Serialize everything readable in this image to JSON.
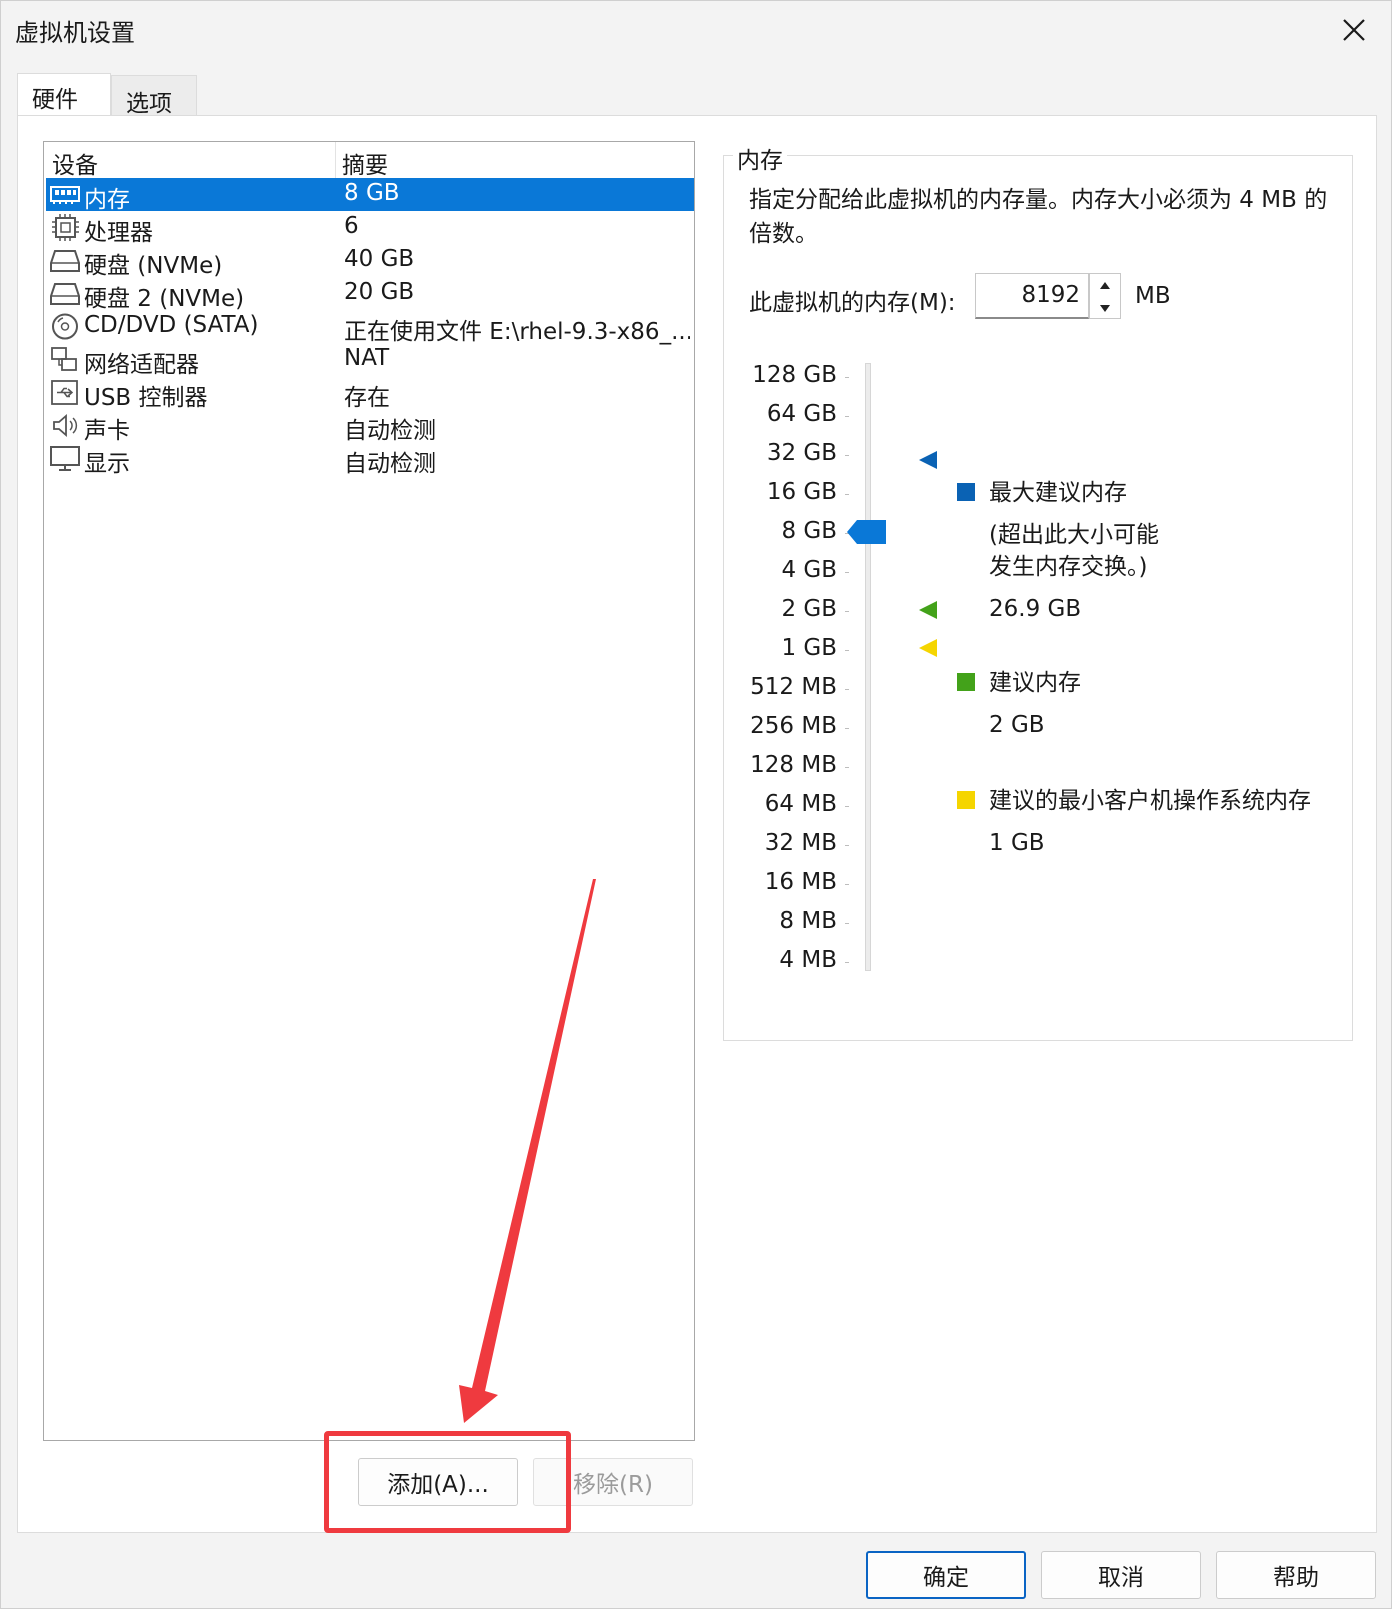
{
  "window": {
    "title": "虚拟机设置"
  },
  "tabs": [
    {
      "label": "硬件"
    },
    {
      "label": "选项"
    }
  ],
  "device_list": {
    "header_device": "设备",
    "header_summary": "摘要",
    "rows": [
      {
        "name": "内存",
        "summary": "8 GB",
        "icon": "memory-icon"
      },
      {
        "name": "处理器",
        "summary": "6",
        "icon": "cpu-icon"
      },
      {
        "name": "硬盘 (NVMe)",
        "summary": "40 GB",
        "icon": "harddisk-icon"
      },
      {
        "name": "硬盘 2 (NVMe)",
        "summary": "20 GB",
        "icon": "harddisk-icon"
      },
      {
        "name": "CD/DVD (SATA)",
        "summary": "正在使用文件 E:\\rhel-9.3-x86_...",
        "icon": "cd-icon"
      },
      {
        "name": "网络适配器",
        "summary": "NAT",
        "icon": "network-icon"
      },
      {
        "name": "USB 控制器",
        "summary": "存在",
        "icon": "usb-icon"
      },
      {
        "name": "声卡",
        "summary": "自动检测",
        "icon": "sound-icon"
      },
      {
        "name": "显示",
        "summary": "自动检测",
        "icon": "display-icon"
      }
    ]
  },
  "list_buttons": {
    "add": "添加(A)...",
    "remove": "移除(R)"
  },
  "memory": {
    "group_title": "内存",
    "description": "指定分配给此虚拟机的内存量。内存大小必须为 4 MB 的倍数。",
    "field_label": "此虚拟机的内存(M):",
    "value": "8192",
    "unit": "MB",
    "scale": [
      "128 GB",
      "64 GB",
      "32 GB",
      "16 GB",
      "8 GB",
      "4 GB",
      "2 GB",
      "1 GB",
      "512 MB",
      "256 MB",
      "128 MB",
      "64 MB",
      "32 MB",
      "16 MB",
      "8 MB",
      "4 MB"
    ],
    "legend": {
      "max_title": "最大建议内存",
      "max_note_1": "(超出此大小可能",
      "max_note_2": "发生内存交换。)",
      "max_value": "26.9 GB",
      "rec_title": "建议内存",
      "rec_value": "2 GB",
      "min_title": "建议的最小客户机操作系统内存",
      "min_value": "1 GB"
    },
    "colors": {
      "max": "#0a62b4",
      "rec": "#43a21a",
      "min": "#f5d500",
      "slider": "#0a78d7"
    }
  },
  "dialog_buttons": {
    "ok": "确定",
    "cancel": "取消",
    "help": "帮助"
  },
  "annotation": {
    "color": "#ef3a3f"
  }
}
